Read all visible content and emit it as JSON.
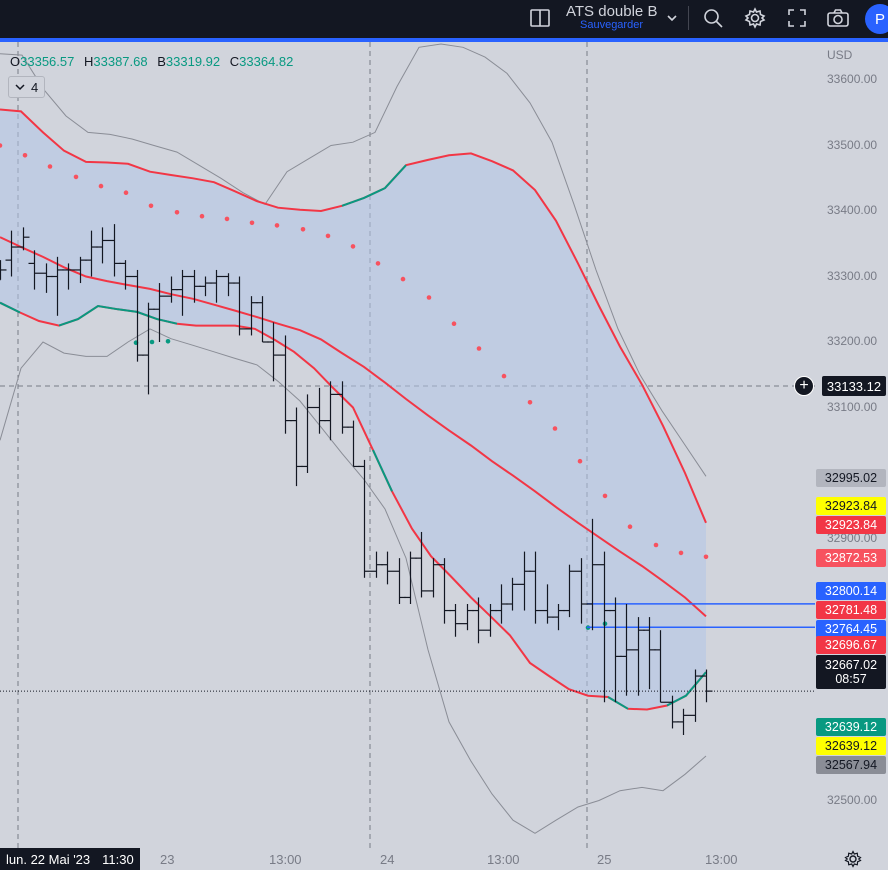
{
  "topbar": {
    "layout_title": "ATS double B",
    "layout_subtitle": "Sauvegarder",
    "profile_initial": "P",
    "icons": [
      "layout-icon",
      "chevron-down-icon",
      "search-icon",
      "gear-icon",
      "fullscreen-icon",
      "camera-icon"
    ]
  },
  "legend": {
    "open_key": "O",
    "open": "33356.57",
    "high_key": "H",
    "high": "33387.68",
    "low_key": "B",
    "low": "33319.92",
    "close_key": "C",
    "close": "33364.82",
    "indicator_count": "4"
  },
  "axis": {
    "currency": "USD",
    "ticks": [
      "33600.00",
      "33500.00",
      "33400.00",
      "33300.00",
      "33200.00",
      "33100.00",
      "32900.00",
      "32500.00"
    ]
  },
  "crosshair": {
    "price": "33133.12"
  },
  "price_labels": {
    "upper_outer": "32995.02",
    "sar_yellow": "32923.84",
    "upper_red": "32923.84",
    "sar_price": "32872.53",
    "blue_high": "32800.14",
    "mid_red": "32781.48",
    "blue_low": "32764.45",
    "lower_red": "32696.67",
    "last_price": "32667.02",
    "countdown": "08:57",
    "lower_green": "32639.12",
    "lower_yellow": "32639.12",
    "lower_outer": "32567.94"
  },
  "time_axis": {
    "cursor_date": "lun. 22 Mai '23",
    "cursor_time": "11:30",
    "labels": [
      "23",
      "13:00",
      "24",
      "13:00",
      "25",
      "13:00"
    ]
  },
  "colors": {
    "background": "#d1d4dc",
    "band_fill": "#b2c4e8",
    "red": "#f23645",
    "green": "#089981",
    "blue": "#2962ff",
    "gray_band": "#8a8d96",
    "sar": "#f7525f",
    "yellow": "#ffff00"
  },
  "chart_data": {
    "type": "candlestick",
    "title": "",
    "ylim": [
      32430,
      33650
    ],
    "x_labels": [
      "23",
      "13:00",
      "24",
      "13:00",
      "25",
      "13:00"
    ],
    "ohlc_last": {
      "open": 33356.57,
      "high": 33387.68,
      "low": 33319.92,
      "close": 33364.82
    },
    "current_price": 32667.02,
    "bars": [
      {
        "o": 33295,
        "h": 33325,
        "l": 33295,
        "c": 33310
      },
      {
        "o": 33325,
        "h": 33370,
        "l": 33300,
        "c": 33345
      },
      {
        "o": 33345,
        "h": 33375,
        "l": 33340,
        "c": 33360
      },
      {
        "o": 33320,
        "h": 33340,
        "l": 33280,
        "c": 33305
      },
      {
        "o": 33305,
        "h": 33320,
        "l": 33275,
        "c": 33300
      },
      {
        "o": 33300,
        "h": 33330,
        "l": 33240,
        "c": 33310
      },
      {
        "o": 33310,
        "h": 33320,
        "l": 33280,
        "c": 33310
      },
      {
        "o": 33310,
        "h": 33330,
        "l": 33290,
        "c": 33325
      },
      {
        "o": 33325,
        "h": 33370,
        "l": 33300,
        "c": 33345
      },
      {
        "o": 33345,
        "h": 33375,
        "l": 33320,
        "c": 33355
      },
      {
        "o": 33355,
        "h": 33380,
        "l": 33300,
        "c": 33320
      },
      {
        "o": 33320,
        "h": 33325,
        "l": 33280,
        "c": 33300
      },
      {
        "o": 33300,
        "h": 33310,
        "l": 33170,
        "c": 33180
      },
      {
        "o": 33180,
        "h": 33260,
        "l": 33120,
        "c": 33250
      },
      {
        "o": 33250,
        "h": 33290,
        "l": 33200,
        "c": 33270
      },
      {
        "o": 33270,
        "h": 33300,
        "l": 33260,
        "c": 33280
      },
      {
        "o": 33280,
        "h": 33310,
        "l": 33240,
        "c": 33300
      },
      {
        "o": 33300,
        "h": 33310,
        "l": 33260,
        "c": 33285
      },
      {
        "o": 33285,
        "h": 33300,
        "l": 33270,
        "c": 33290
      },
      {
        "o": 33290,
        "h": 33310,
        "l": 33260,
        "c": 33300
      },
      {
        "o": 33300,
        "h": 33305,
        "l": 33270,
        "c": 33290
      },
      {
        "o": 33290,
        "h": 33300,
        "l": 33210,
        "c": 33220
      },
      {
        "o": 33220,
        "h": 33270,
        "l": 33210,
        "c": 33260
      },
      {
        "o": 33260,
        "h": 33270,
        "l": 33200,
        "c": 33200
      },
      {
        "o": 33200,
        "h": 33230,
        "l": 33140,
        "c": 33180
      },
      {
        "o": 33180,
        "h": 33210,
        "l": 33060,
        "c": 33080
      },
      {
        "o": 33080,
        "h": 33100,
        "l": 32980,
        "c": 33010
      },
      {
        "o": 33010,
        "h": 33120,
        "l": 33000,
        "c": 33100
      },
      {
        "o": 33100,
        "h": 33130,
        "l": 33060,
        "c": 33080
      },
      {
        "o": 33080,
        "h": 33140,
        "l": 33050,
        "c": 33120
      },
      {
        "o": 33120,
        "h": 33140,
        "l": 33060,
        "c": 33070
      },
      {
        "o": 33070,
        "h": 33080,
        "l": 33010,
        "c": 33010
      },
      {
        "o": 33010,
        "h": 33020,
        "l": 32840,
        "c": 32850
      },
      {
        "o": 32850,
        "h": 32880,
        "l": 32840,
        "c": 32860
      },
      {
        "o": 32860,
        "h": 32880,
        "l": 32830,
        "c": 32850
      },
      {
        "o": 32850,
        "h": 32870,
        "l": 32800,
        "c": 32810
      },
      {
        "o": 32810,
        "h": 32880,
        "l": 32800,
        "c": 32870
      },
      {
        "o": 32870,
        "h": 32910,
        "l": 32810,
        "c": 32820
      },
      {
        "o": 32820,
        "h": 32870,
        "l": 32810,
        "c": 32860
      },
      {
        "o": 32860,
        "h": 32870,
        "l": 32770,
        "c": 32790
      },
      {
        "o": 32790,
        "h": 32800,
        "l": 32750,
        "c": 32770
      },
      {
        "o": 32770,
        "h": 32800,
        "l": 32760,
        "c": 32790
      },
      {
        "o": 32790,
        "h": 32810,
        "l": 32740,
        "c": 32760
      },
      {
        "o": 32760,
        "h": 32800,
        "l": 32750,
        "c": 32790
      },
      {
        "o": 32790,
        "h": 32830,
        "l": 32770,
        "c": 32800
      },
      {
        "o": 32800,
        "h": 32840,
        "l": 32790,
        "c": 32830
      },
      {
        "o": 32830,
        "h": 32880,
        "l": 32790,
        "c": 32850
      },
      {
        "o": 32850,
        "h": 32880,
        "l": 32770,
        "c": 32790
      },
      {
        "o": 32790,
        "h": 32830,
        "l": 32770,
        "c": 32780
      },
      {
        "o": 32780,
        "h": 32800,
        "l": 32760,
        "c": 32790
      },
      {
        "o": 32790,
        "h": 32860,
        "l": 32780,
        "c": 32850
      },
      {
        "o": 32850,
        "h": 32870,
        "l": 32770,
        "c": 32800
      },
      {
        "o": 32800,
        "h": 32930,
        "l": 32760,
        "c": 32860
      },
      {
        "o": 32860,
        "h": 32880,
        "l": 32650,
        "c": 32790
      },
      {
        "o": 32790,
        "h": 32810,
        "l": 32650,
        "c": 32720
      },
      {
        "o": 32720,
        "h": 32800,
        "l": 32660,
        "c": 32730
      },
      {
        "o": 32730,
        "h": 32780,
        "l": 32660,
        "c": 32760
      },
      {
        "o": 32760,
        "h": 32780,
        "l": 32670,
        "c": 32730
      },
      {
        "o": 32730,
        "h": 32760,
        "l": 32650,
        "c": 32650
      },
      {
        "o": 32650,
        "h": 32660,
        "l": 32610,
        "c": 32620
      },
      {
        "o": 32620,
        "h": 32640,
        "l": 32600,
        "c": 32630
      },
      {
        "o": 32630,
        "h": 32700,
        "l": 32620,
        "c": 32690
      },
      {
        "o": 32690,
        "h": 32700,
        "l": 32650,
        "c": 32667
      }
    ],
    "upper_red": [
      33555,
      33552,
      33520,
      33492,
      33475,
      33474,
      33472,
      33460,
      33455,
      33450,
      33444,
      33430,
      33415,
      33405,
      33402,
      33400,
      33408,
      33420,
      33435,
      33470,
      33478,
      33485,
      33488,
      33476,
      33462,
      33432,
      33385,
      33320,
      33255,
      33193,
      33135,
      33072,
      33000,
      32924
    ],
    "mid_red": [
      33360,
      33345,
      33330,
      33314,
      33300,
      33293,
      33287,
      33281,
      33273,
      33266,
      33257,
      33248,
      33238,
      33228,
      33218,
      33204,
      33183,
      33162,
      33138,
      33113,
      33088,
      33065,
      33042,
      33018,
      32996,
      32972,
      32948,
      32924,
      32902,
      32880,
      32858,
      32835,
      32810,
      32781
    ],
    "lower_red": [
      33260,
      33245,
      33232,
      33225,
      33235,
      33255,
      33250,
      33246,
      33235,
      33228,
      33225,
      33225,
      33225,
      33220,
      33203,
      33185,
      33160,
      33130,
      33100,
      33035,
      32972,
      32915,
      32873,
      32842,
      32810,
      32782,
      32752,
      32710,
      32690,
      32670,
      32660,
      32658,
      32640,
      32639,
      32645,
      32660,
      32696
    ],
    "outer_upper": [
      33640,
      33638,
      33585,
      33545,
      33520,
      33517,
      33510,
      33500,
      33490,
      33470,
      33450,
      33428,
      33410,
      33460,
      33480,
      33500,
      33505,
      33520,
      33590,
      33650,
      33655,
      33650,
      33635,
      33610,
      33565,
      33505,
      33410,
      33310,
      33220,
      33150,
      33095,
      33045,
      32995
    ],
    "outer_lower": [
      33050,
      33160,
      33200,
      33183,
      33178,
      33178,
      33200,
      33220,
      33205,
      33195,
      33185,
      33175,
      33165,
      33140,
      33110,
      33070,
      33030,
      32990,
      32945,
      32870,
      32730,
      32620,
      32560,
      32510,
      32470,
      32450,
      32470,
      32490,
      32500,
      32515,
      32520,
      32515,
      32540,
      32568
    ],
    "sar": [
      33500,
      33485,
      33468,
      33452,
      33438,
      33428,
      33408,
      33398,
      33392,
      33388,
      33382,
      33378,
      33372,
      33362,
      33346,
      33320,
      33296,
      33268,
      33228,
      33190,
      33148,
      33108,
      33068,
      33018,
      32965,
      32918,
      32890,
      32878,
      32872
    ],
    "sar_low": [
      33199,
      33200,
      33201,
      32764,
      32770
    ],
    "blue_lines": [
      32800.14,
      32764.45
    ]
  }
}
